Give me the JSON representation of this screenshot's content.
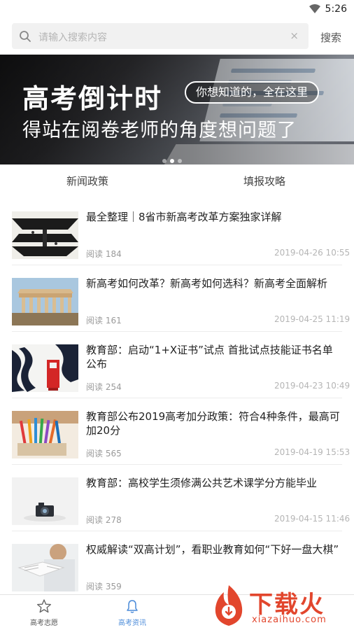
{
  "status_bar": {
    "time": "5:26",
    "wifi_icon": "wifi-icon"
  },
  "search": {
    "placeholder": "请输入搜索内容",
    "clear_glyph": "×",
    "button_label": "搜索"
  },
  "banner": {
    "headline": "高考倒计时",
    "pill_text": "你想知道的，全在这里",
    "subline": "得站在阅卷老师的角度想问题了",
    "slide_count": 3,
    "active_slide": 2
  },
  "tabs": [
    {
      "label": "新闻政策"
    },
    {
      "label": "填报攻略"
    }
  ],
  "articles": [
    {
      "title": "最全整理｜8省市新高考改革方案独家详解",
      "reads": "阅读 184",
      "date": "2019-04-26 10:55"
    },
    {
      "title": "新高考如何改革？新高考如何选科？新高考全面解析",
      "reads": "阅读 161",
      "date": "2019-04-25 11:19"
    },
    {
      "title": "教育部：启动“1+X证书”试点 首批试点技能证书名单公布",
      "reads": "阅读 254",
      "date": "2019-04-23 10:49"
    },
    {
      "title": "教育部公布2019高考加分政策：符合4种条件，最高可加20分",
      "reads": "阅读 565",
      "date": "2019-04-19 15:53"
    },
    {
      "title": "教育部：高校学生须修满公共艺术课学分方能毕业",
      "reads": "阅读 278",
      "date": "2019-04-15 11:46"
    },
    {
      "title": "权威解读“双高计划”，看职业教育如何“下好一盘大棋”",
      "reads": "阅读 359",
      "date": ""
    }
  ],
  "bottom_nav": [
    {
      "label": "高考志愿",
      "icon": "star-icon"
    },
    {
      "label": "高考资讯",
      "icon": "bell-icon"
    }
  ],
  "watermark": {
    "text": "下载火",
    "sub": "xiazaihuo.com"
  },
  "colors": {
    "accent": "#4b8bd9",
    "watermark": "#e2462d"
  }
}
